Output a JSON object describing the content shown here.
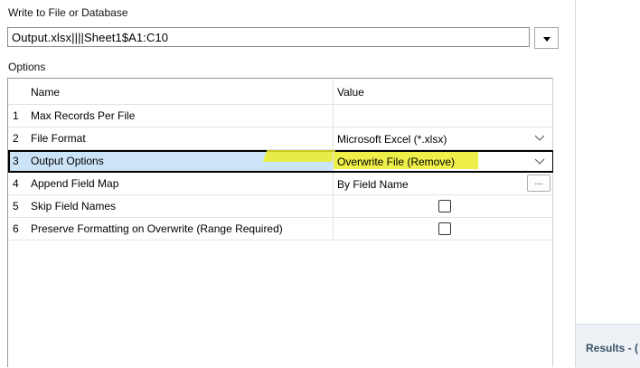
{
  "section_title": "Write to File or Database",
  "output_path": "Output.xlsx||||Sheet1$A1:C10",
  "options_title": "Options",
  "grid": {
    "headers": {
      "name": "Name",
      "value": "Value"
    },
    "rows": [
      {
        "num": "1",
        "name": "Max Records Per File",
        "value": ""
      },
      {
        "num": "2",
        "name": "File Format",
        "value": "Microsoft Excel (*.xlsx)"
      },
      {
        "num": "3",
        "name": "Output Options",
        "value": "Overwrite File (Remove)"
      },
      {
        "num": "4",
        "name": "Append Field Map",
        "value": "By Field Name",
        "button": "..."
      },
      {
        "num": "5",
        "name": "Skip Field Names",
        "checked": false
      },
      {
        "num": "6",
        "name": "Preserve Formatting on Overwrite (Range Required)",
        "checked": false
      }
    ]
  },
  "results_tab": "Results - (",
  "colors": {
    "selection": "#cce4f7",
    "highlight": "#ecec2a",
    "results_bg": "#eef2f7"
  },
  "icons": [
    "dropdown-triangle-icon",
    "chevron-down-icon",
    "checkbox-icon"
  ]
}
